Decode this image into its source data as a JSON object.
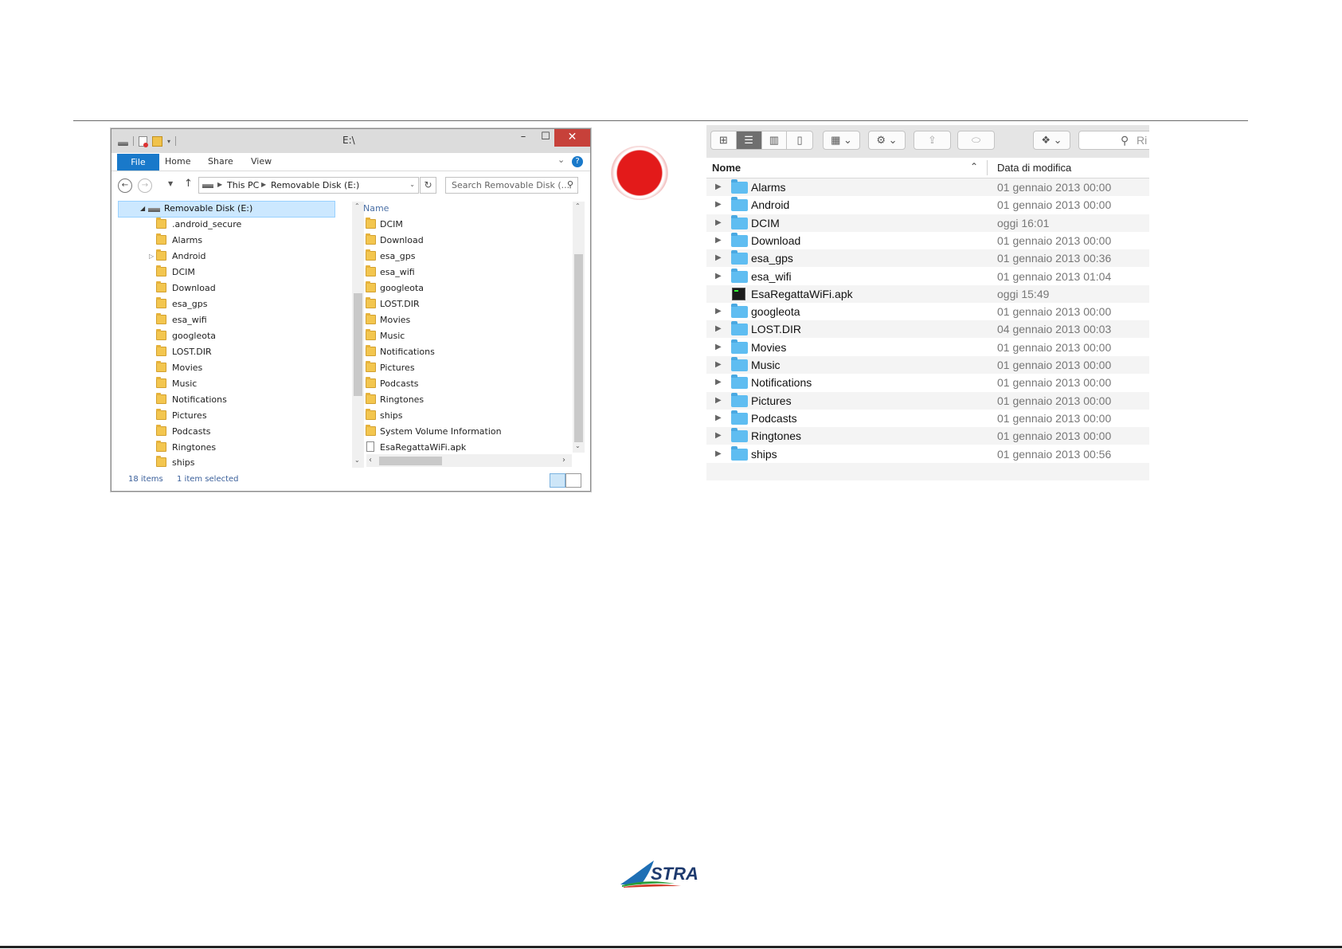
{
  "explorer": {
    "title": "E:\\",
    "window_controls": {
      "minimize": "–",
      "maximize": "☐",
      "close": "✕"
    },
    "ribbon_tabs": [
      "File",
      "Home",
      "Share",
      "View"
    ],
    "help": "?",
    "address": {
      "crumb1": "This PC",
      "crumb2": "Removable Disk (E:)"
    },
    "search_placeholder": "Search Removable Disk (...",
    "tree_root": "Removable Disk (E:)",
    "tree": [
      ".android_secure",
      "Alarms",
      "Android",
      "DCIM",
      "Download",
      "esa_gps",
      "esa_wifi",
      "googleota",
      "LOST.DIR",
      "Movies",
      "Music",
      "Notifications",
      "Pictures",
      "Podcasts",
      "Ringtones",
      "ships"
    ],
    "list_header": "Name",
    "list": [
      "DCIM",
      "Download",
      "esa_gps",
      "esa_wifi",
      "googleota",
      "LOST.DIR",
      "Movies",
      "Music",
      "Notifications",
      "Pictures",
      "Podcasts",
      "Ringtones",
      "ships",
      "System Volume Information"
    ],
    "list_file": "EsaRegattaWiFi.apk",
    "status_items": "18 items",
    "status_selected": "1 item selected"
  },
  "finder": {
    "col_name": "Nome",
    "col_date": "Data di modifica",
    "search_placeholder": "Ri",
    "rows": [
      {
        "name": "Alarms",
        "date": "01 gennaio 2013 00:00",
        "type": "folder"
      },
      {
        "name": "Android",
        "date": "01 gennaio 2013 00:00",
        "type": "folder"
      },
      {
        "name": "DCIM",
        "date": "oggi 16:01",
        "type": "folder"
      },
      {
        "name": "Download",
        "date": "01 gennaio 2013 00:00",
        "type": "folder"
      },
      {
        "name": "esa_gps",
        "date": "01 gennaio 2013 00:36",
        "type": "folder"
      },
      {
        "name": "esa_wifi",
        "date": "01 gennaio 2013 01:04",
        "type": "folder"
      },
      {
        "name": "EsaRegattaWiFi.apk",
        "date": "oggi 15:49",
        "type": "file"
      },
      {
        "name": "googleota",
        "date": "01 gennaio 2013 00:00",
        "type": "folder"
      },
      {
        "name": "LOST.DIR",
        "date": "04 gennaio 2013 00:03",
        "type": "folder"
      },
      {
        "name": "Movies",
        "date": "01 gennaio 2013 00:00",
        "type": "folder"
      },
      {
        "name": "Music",
        "date": "01 gennaio 2013 00:00",
        "type": "folder"
      },
      {
        "name": "Notifications",
        "date": "01 gennaio 2013 00:00",
        "type": "folder"
      },
      {
        "name": "Pictures",
        "date": "01 gennaio 2013 00:00",
        "type": "folder"
      },
      {
        "name": "Podcasts",
        "date": "01 gennaio 2013 00:00",
        "type": "folder"
      },
      {
        "name": "Ringtones",
        "date": "01 gennaio 2013 00:00",
        "type": "folder"
      },
      {
        "name": "ships",
        "date": "01 gennaio 2013 00:56",
        "type": "folder"
      }
    ]
  },
  "logo_text": "STRA",
  "colors": {
    "accent_blue": "#1979ca",
    "close_red": "#c7413a",
    "record_red": "#e31a1a",
    "mac_folder": "#5fbdf1"
  }
}
